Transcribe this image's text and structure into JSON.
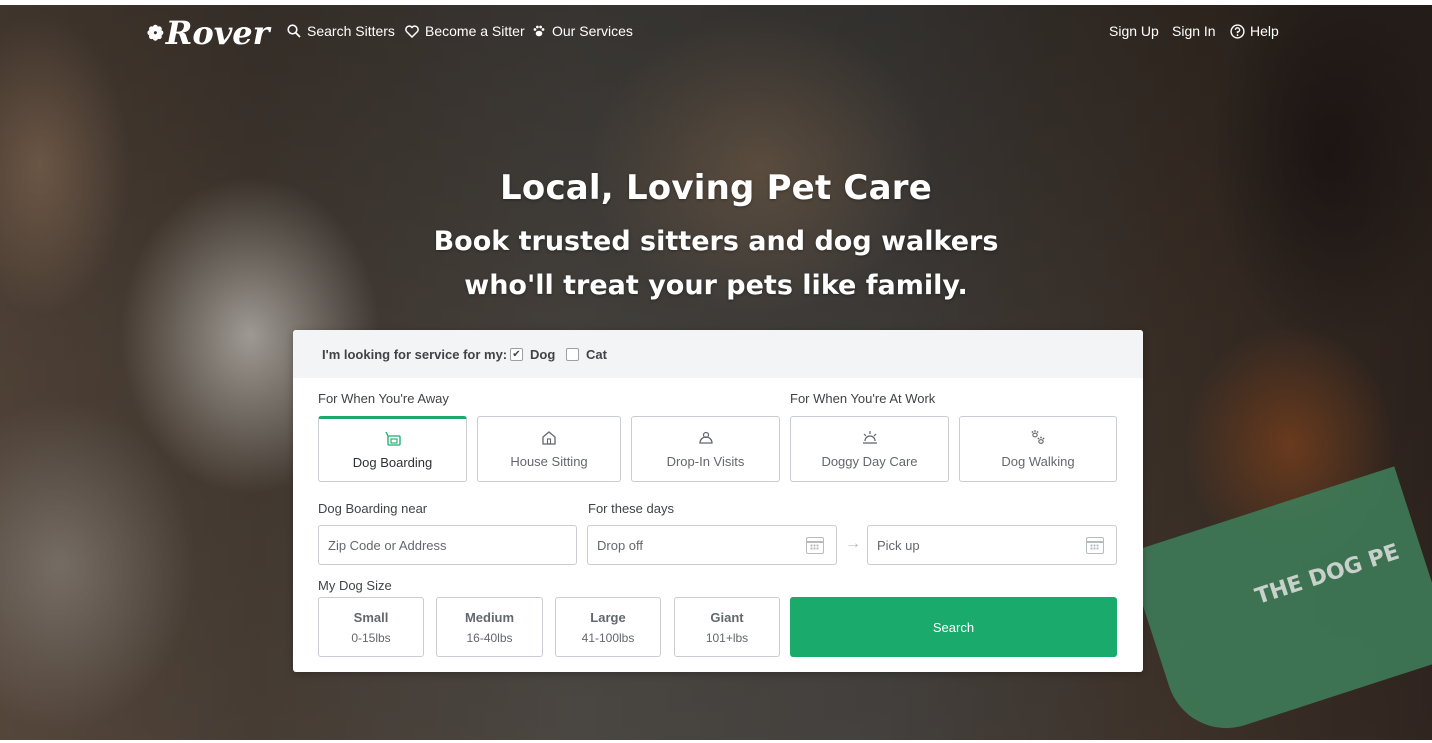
{
  "nav": {
    "logo_text": "Rover",
    "items": [
      {
        "label": "Search Sitters",
        "icon": "search-icon"
      },
      {
        "label": "Become a Sitter",
        "icon": "heart-icon"
      },
      {
        "label": "Our Services",
        "icon": "paw-icon"
      }
    ],
    "right_items": [
      {
        "label": "Sign Up"
      },
      {
        "label": "Sign In"
      },
      {
        "label": "Help",
        "icon": "help-icon"
      }
    ]
  },
  "hero": {
    "title": "Local, Loving Pet Care",
    "subtitle": "Book trusted sitters and dog walkers who'll treat your pets like family."
  },
  "search_form": {
    "pet_prompt": "I'm looking for service for my:",
    "pets": [
      {
        "label": "Dog",
        "checked": true
      },
      {
        "label": "Cat",
        "checked": false
      }
    ],
    "away_label": "For When You're Away",
    "work_label": "For When You're At Work",
    "services": [
      {
        "label": "Dog Boarding",
        "icon": "boarding-icon",
        "active": true
      },
      {
        "label": "House Sitting",
        "icon": "house-icon",
        "active": false
      },
      {
        "label": "Drop-In Visits",
        "icon": "drop-in-icon",
        "active": false
      },
      {
        "label": "Doggy Day Care",
        "icon": "sun-icon",
        "active": false
      },
      {
        "label": "Dog Walking",
        "icon": "paw-prints-icon",
        "active": false
      }
    ],
    "location_label": "Dog Boarding near",
    "location_placeholder": "Zip Code or Address",
    "dates_label": "For these days",
    "dropoff_placeholder": "Drop off",
    "pickup_placeholder": "Pick up",
    "size_label": "My Dog Size",
    "sizes": [
      {
        "name": "Small",
        "range": "0-15lbs"
      },
      {
        "name": "Medium",
        "range": "16-40lbs"
      },
      {
        "name": "Large",
        "range": "41-100lbs"
      },
      {
        "name": "Giant",
        "range": "101+lbs"
      }
    ],
    "search_label": "Search"
  },
  "colors": {
    "brand_green": "#1aaa6b",
    "text_dark": "#404347",
    "text_muted": "#62686e"
  }
}
